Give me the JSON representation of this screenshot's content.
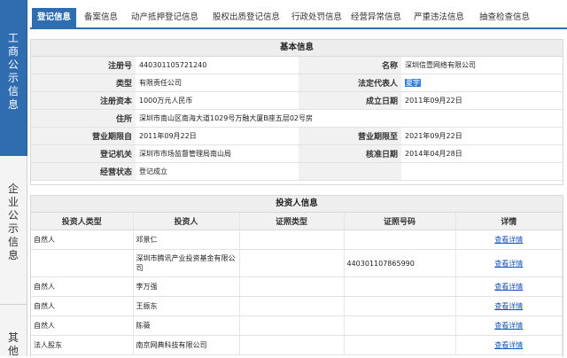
{
  "sidebar": {
    "items": [
      {
        "label": "工商公示信息",
        "chars": [
          "工",
          "商",
          "公",
          "示",
          "信",
          "息"
        ]
      },
      {
        "label": "企业公示信息",
        "chars": [
          "企",
          "业",
          "公",
          "示",
          "信",
          "息"
        ]
      },
      {
        "label": "其他",
        "chars": [
          "其",
          "他"
        ]
      }
    ]
  },
  "tabs": [
    "登记信息",
    "备案信息",
    "动产抵押登记信息",
    "股权出质登记信息",
    "行政处罚信息",
    "经营异常信息",
    "严重违法信息",
    "抽查检查信息"
  ],
  "basic": {
    "title": "基本信息",
    "reg_no_label": "注册号",
    "reg_no": "440301105721240",
    "name_label": "名称",
    "name": "深圳信壹网络有限公司",
    "type_label": "类型",
    "type": "有限责任公司",
    "legal_rep_label": "法定代表人",
    "legal_rep": "夏宇",
    "capital_label": "注册资本",
    "capital": "1000万元人民币",
    "est_date_label": "成立日期",
    "est_date": "2011年09月22日",
    "address_label": "住所",
    "address": "深圳市南山区南海大道1029号万融大厦B座五层02号房",
    "term_from_label": "营业期限自",
    "term_from": "2011年09月22日",
    "term_to_label": "营业期限至",
    "term_to": "2021年09月22日",
    "authority_label": "登记机关",
    "authority": "深圳市市场监督管理局南山局",
    "approve_date_label": "核准日期",
    "approve_date": "2014年04月28日",
    "status_label": "经营状态",
    "status": "登记成立"
  },
  "investors": {
    "title": "投资人信息",
    "headers": [
      "投资人类型",
      "投资人",
      "证照类型",
      "证照号码",
      "详情"
    ],
    "rows": [
      {
        "type": "自然人",
        "name": "邓景仁",
        "id_type": "",
        "id_no": "",
        "detail": "查看详情"
      },
      {
        "type": "",
        "name": "深圳市腾讯产业投资基金有限公司",
        "id_type": "",
        "id_no": "440301107865990",
        "detail": "查看详情"
      },
      {
        "type": "自然人",
        "name": "李万强",
        "id_type": "",
        "id_no": "",
        "detail": "查看详情"
      },
      {
        "type": "自然人",
        "name": "王振东",
        "id_type": "",
        "id_no": "",
        "detail": "查看详情"
      },
      {
        "type": "自然人",
        "name": "陈薇",
        "id_type": "",
        "id_no": "",
        "detail": "查看详情"
      },
      {
        "type": "法人股东",
        "name": "南京网典科技有限公司",
        "id_type": "",
        "id_no": "",
        "detail": "查看详情"
      }
    ]
  },
  "colors": {
    "accent": "#2f6db0",
    "link": "#1a56b8",
    "label_bg": "#f1f1f1"
  }
}
